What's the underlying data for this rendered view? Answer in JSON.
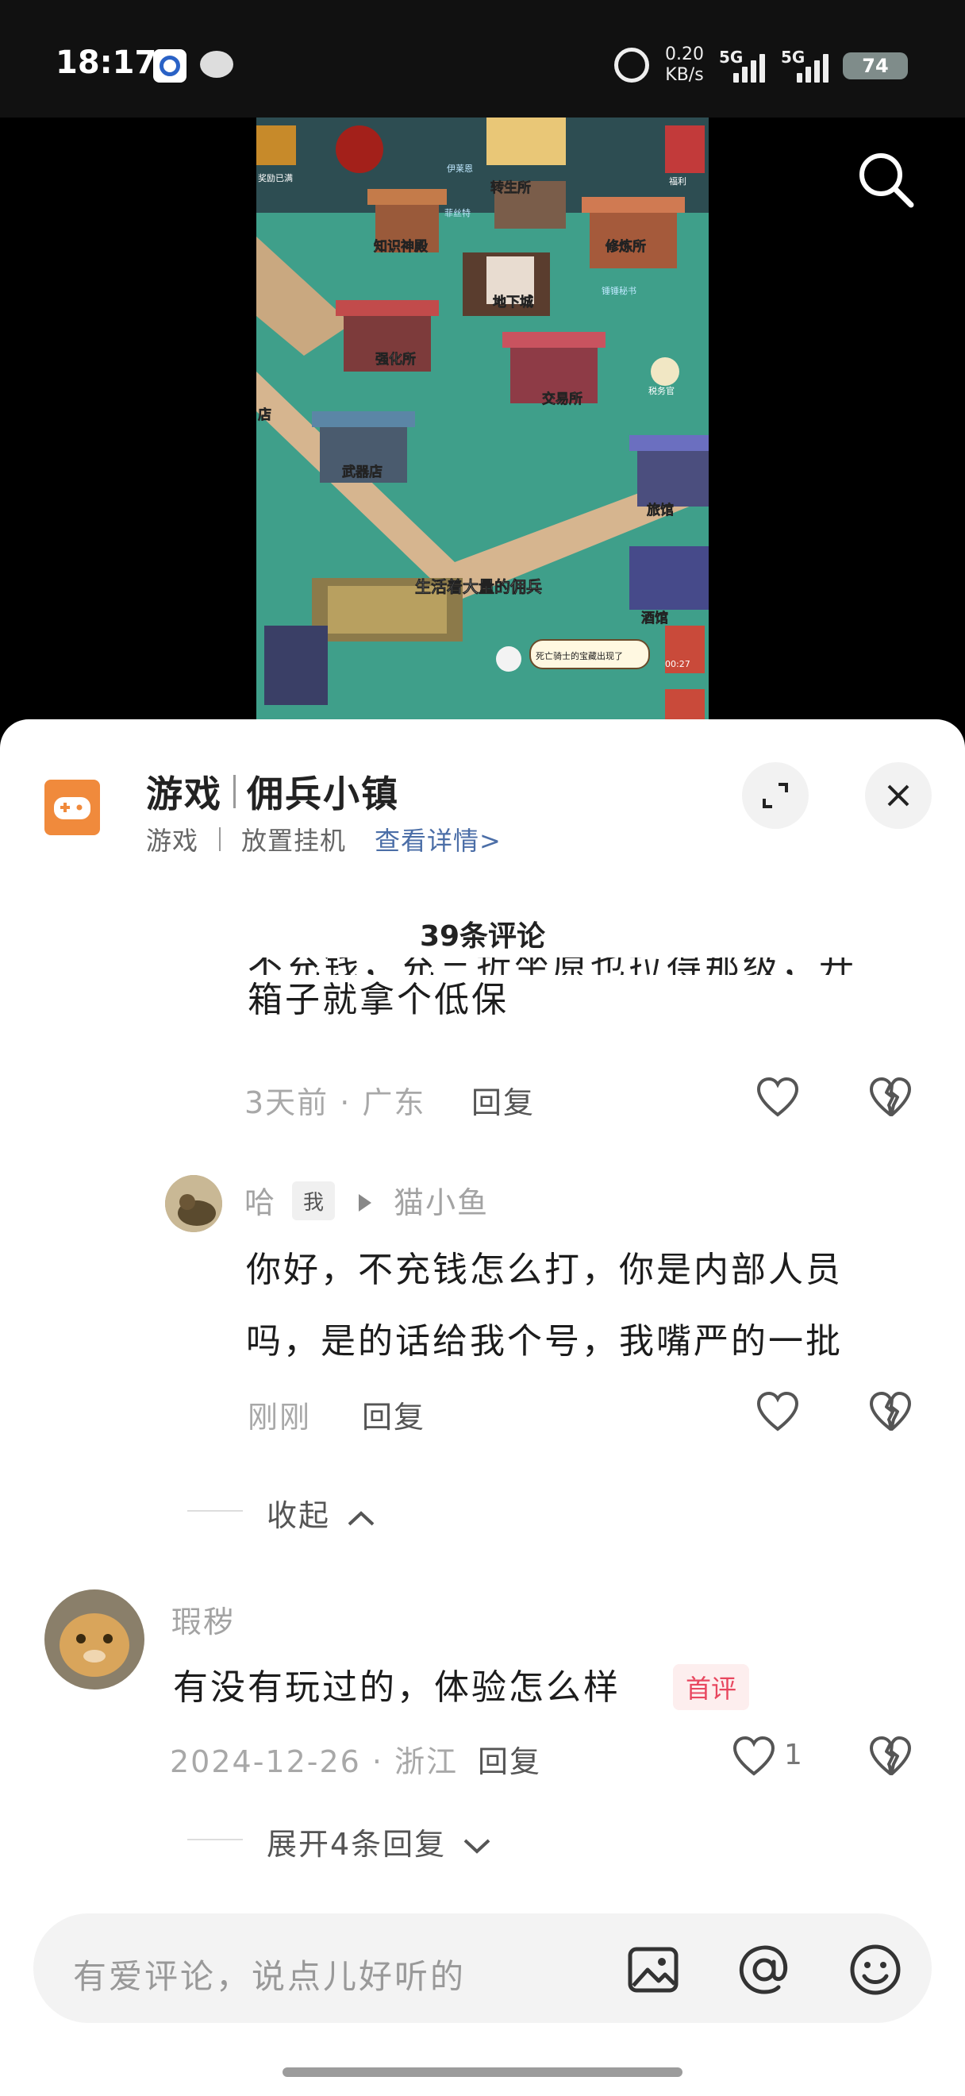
{
  "status_bar": {
    "time": "18:17",
    "speed_top": "0.20",
    "speed_bottom": "KB/s",
    "net1": "5G",
    "net2": "5G",
    "battery": "74"
  },
  "video": {
    "labels": [
      "转生所",
      "知识神殿",
      "修炼所",
      "地下城",
      "强化所",
      "交易所",
      "税务官",
      "武器店",
      "旅馆",
      "生活着大量的佣兵",
      "酒馆",
      "死亡骑士的宝藏出现了",
      "奖励已满",
      "福利",
      "00:27",
      "伊莱恩",
      "菲丝特",
      "锤锤秘书",
      "店"
    ]
  },
  "sheet": {
    "category": "游戏",
    "game_name": "佣兵小镇",
    "tag1": "游戏",
    "tag2": "放置挂机",
    "details_link": "查看详情>",
    "comment_count": "39条评论",
    "clipped_line": "不充钱，充三折坐原也拉得那级，开",
    "comments": [
      {
        "text": "箱子就拿个低保",
        "time": "3天前 · 广东",
        "reply": "回复"
      },
      {
        "user": "哈",
        "me_tag": "我",
        "reply_to": "猫小鱼",
        "text_line1": "你好，不充钱怎么打，你是内部人员",
        "text_line2": "吗，是的话给我个号，我嘴严的一批",
        "time": "刚刚",
        "reply": "回复"
      },
      {
        "collapse": "收起"
      },
      {
        "user": "瑕秽",
        "text": "有没有玩过的，体验怎么样",
        "badge": "首评",
        "time": "2024-12-26 · 浙江",
        "reply": "回复",
        "likes": "1",
        "expand": "展开4条回复"
      }
    ]
  },
  "input": {
    "placeholder": "有爱评论，说点儿好听的"
  },
  "colors": {
    "accent_orange": "#f08a3c",
    "link_blue": "#4b6ea7",
    "badge_red": "#e8475f"
  }
}
